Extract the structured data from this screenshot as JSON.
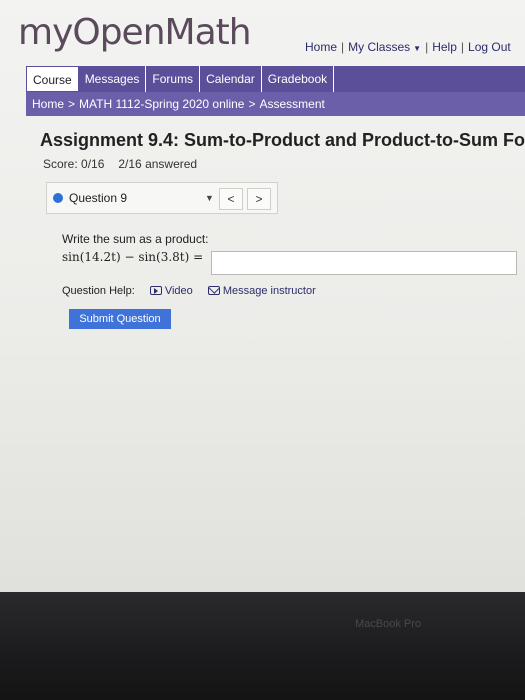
{
  "header": {
    "logo": "myOpenMath",
    "links": {
      "home": "Home",
      "my_classes": "My Classes",
      "help": "Help",
      "logout": "Log Out"
    },
    "separator": "|"
  },
  "nav": {
    "tabs": [
      "Course",
      "Messages",
      "Forums",
      "Calendar",
      "Gradebook"
    ]
  },
  "breadcrumb": {
    "home": "Home",
    "course": "MATH 1112-Spring 2020 online",
    "current": "Assessment",
    "separator": ">"
  },
  "assessment": {
    "title": "Assignment 9.4: Sum-to-Product and Product-to-Sum Fo",
    "score_label": "Score: 0/16",
    "answered": "2/16 answered"
  },
  "question_nav": {
    "selected": "Question 9",
    "prev": "<",
    "next": ">"
  },
  "question": {
    "prompt": "Write the sum as a product:",
    "expression": "sin(14.2t) − sin(3.8t) =",
    "answer_value": ""
  },
  "help": {
    "label": "Question Help:",
    "video": "Video",
    "message": "Message instructor"
  },
  "submit_label": "Submit Question",
  "device": {
    "brand": "MacBook Pro"
  },
  "colors": {
    "nav": "#5b4f9a",
    "submit": "#3f73d9",
    "dot": "#2f6fd6"
  }
}
